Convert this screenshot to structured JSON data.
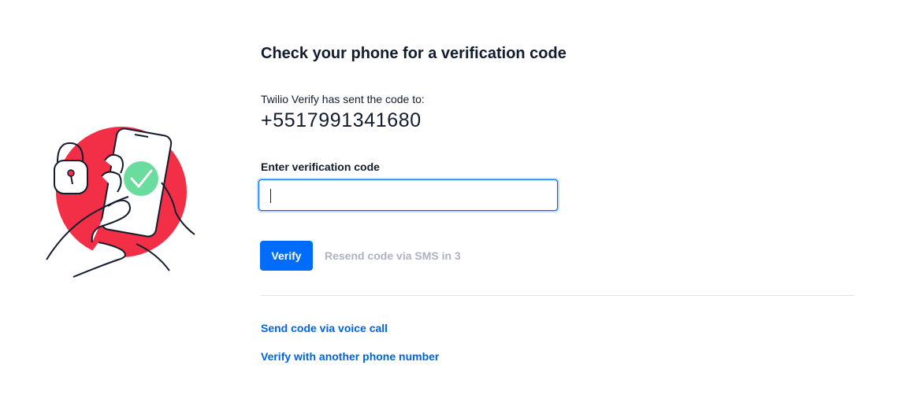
{
  "verification": {
    "title": "Check your phone for a verification code",
    "sent_label": "Twilio Verify has sent the code to:",
    "phone_number": "+5517991341680",
    "field_label": "Enter verification code",
    "field_value": "",
    "verify_label": "Verify",
    "resend_label": "Resend code via SMS in 3"
  },
  "alternatives": {
    "voice_call_label": "Send code via voice call",
    "other_number_label": "Verify with another phone number"
  },
  "illustration": {
    "icons": [
      "phone-icon",
      "padlock-icon",
      "checkmark-icon",
      "hand-icon"
    ]
  },
  "colors": {
    "accent": "#006dfa",
    "link": "#0263e0",
    "disabled_text": "#aeb2c1",
    "illustration_red": "#f22f46",
    "illustration_green": "#6adc9e"
  }
}
